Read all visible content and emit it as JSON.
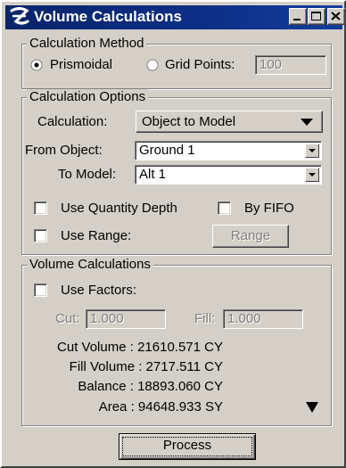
{
  "window": {
    "title": "Volume Calculations",
    "icon": "app-logo-icon",
    "controls": [
      "minimize-icon",
      "maximize-icon",
      "close-icon"
    ]
  },
  "calculation_method": {
    "group_label": "Calculation Method",
    "prismoidal_label": "Prismoidal",
    "prismoidal_selected": true,
    "grid_points_label": "Grid Points:",
    "grid_points_selected": false,
    "grid_points_value": "100"
  },
  "calculation_options": {
    "group_label": "Calculation Options",
    "calculation_label": "Calculation:",
    "calculation_value": "Object to Model",
    "from_object_label": "From Object:",
    "from_object_value": "Ground 1",
    "to_model_label": "To Model:",
    "to_model_value": "Alt 1",
    "use_quantity_depth_label": "Use Quantity Depth",
    "use_quantity_depth_checked": false,
    "by_fifo_label": "By FIFO",
    "by_fifo_checked": false,
    "use_range_label": "Use Range:",
    "use_range_checked": false,
    "range_button_label": "Range"
  },
  "volume_calculations": {
    "group_label": "Volume Calculations",
    "use_factors_label": "Use Factors:",
    "use_factors_checked": false,
    "cut_label": "Cut:",
    "cut_value": "1.000",
    "fill_label": "Fill:",
    "fill_value": "1.000",
    "cut_volume": "Cut Volume : 21610.571 CY",
    "fill_volume": "Fill Volume : 2717.511 CY",
    "balance": "Balance : 18893.060 CY",
    "area": "Area : 94648.933 SY"
  },
  "process_button_label": "Process"
}
